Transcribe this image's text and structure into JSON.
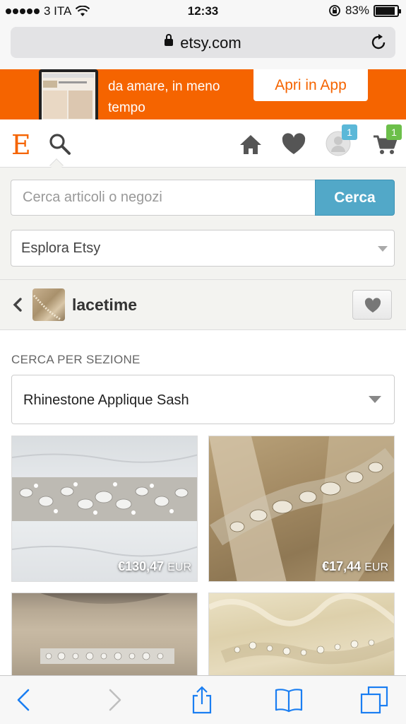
{
  "status_bar": {
    "carrier": "3 ITA",
    "time": "12:33",
    "battery": "83%",
    "battery_level": 0.83
  },
  "browser": {
    "url": "etsy.com"
  },
  "app_banner": {
    "text": "da amare, in meno tempo",
    "button": "Apri in App"
  },
  "header": {
    "logo": "E",
    "notifications_count": "1",
    "cart_count": "1"
  },
  "search": {
    "placeholder": "Cerca articoli o negozi",
    "button": "Cerca",
    "explore": "Esplora Etsy"
  },
  "shop": {
    "name": "lacetime"
  },
  "section": {
    "label": "CERCA PER SEZIONE",
    "selected": "Rhinestone Applique Sash"
  },
  "listings": [
    {
      "price": "€130,47",
      "currency": "EUR"
    },
    {
      "price": "€17,44",
      "currency": "EUR"
    },
    {
      "price": "",
      "currency": ""
    },
    {
      "price": "",
      "currency": ""
    }
  ],
  "colors": {
    "etsy_orange": "#f56400",
    "search_blue": "#52a8c8",
    "badge_blue": "#5bb8d8",
    "badge_green": "#6cbf4a",
    "ios_blue": "#1a7ef2"
  }
}
